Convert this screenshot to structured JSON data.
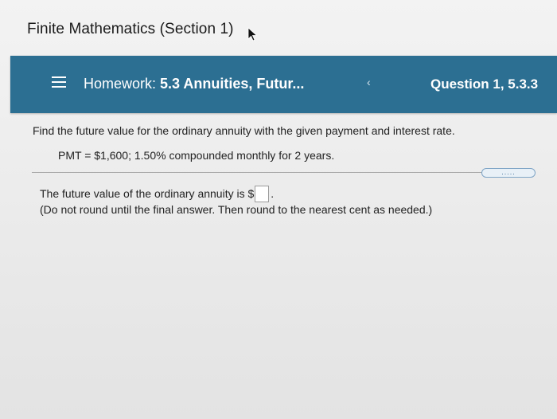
{
  "header": {
    "course_title": "Finite Mathematics (Section 1)"
  },
  "homework_bar": {
    "prefix": "Homework:",
    "assignment": "5.3 Annuities, Futur...",
    "question": "Question 1, 5.3.3",
    "background_color": "#2c6f92",
    "icons": [
      "menu-icon",
      "previous-chevron-icon"
    ]
  },
  "problem": {
    "prompt": "Find the future value for the ordinary annuity with the given payment and interest rate.",
    "given": "PMT = $1,600; 1.50% compounded monthly for 2 years.",
    "more_button_label": "....."
  },
  "answer": {
    "lead_text": "The future value of the ordinary annuity is $",
    "input_value": "",
    "trailing": ".",
    "instruction": "(Do not round until the final answer. Then round to the nearest cent as needed.)"
  }
}
